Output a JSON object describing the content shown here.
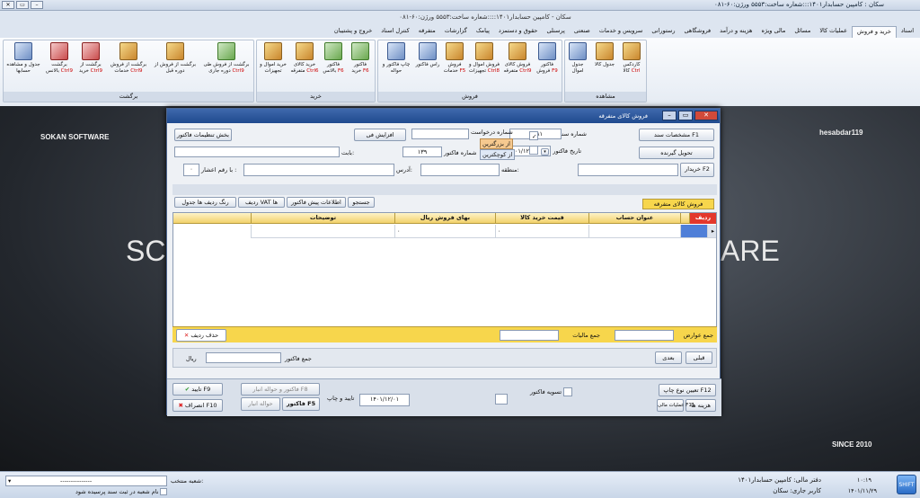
{
  "window": {
    "title": "سکان : کامپین حسابدار۱۴۰۱:::شعاره ساخت:۵۵۵۳    ورژن:۶۰-۰۸۱"
  },
  "app_title": "سکان - کامپین حسابدار۱۴۰۱::::شعاره ساخت:۵۵۵۳    ورژن:۶۰-۰۸۱",
  "tabs": [
    "اسناد",
    "خرید و فروش",
    "عملیات کالا",
    "مسائل",
    "مالی ویژه",
    "هزینه و درآمد",
    "فروشگاهی",
    "رستورانی",
    "سرویس و خدمات",
    "صنعتی",
    "پرسنلی",
    "حقوق و دستمزد",
    "پیامک",
    "گزارشات",
    "متفرقه",
    "کنترل اسناد",
    "خروج و پشتیبان"
  ],
  "ribbon": {
    "groups": [
      {
        "label": "مشاهده",
        "buttons": [
          {
            "l1": "کاردکس",
            "l2": "کالا",
            "hk": "Ctrl"
          },
          {
            "l1": "جدول کالا",
            "l2": "",
            "hk": ""
          },
          {
            "l1": "جدول",
            "l2": "اموال",
            "hk": ""
          }
        ]
      },
      {
        "label": "فروش",
        "buttons": [
          {
            "l1": "فاکتور",
            "l2": "فروش",
            "hk": "F9"
          },
          {
            "l1": "فروش کالای",
            "l2": "متفرقه",
            "hk": "Ctrl9"
          },
          {
            "l1": "فروش اموال و",
            "l2": "تجهیزات",
            "hk": "Ctrl8"
          },
          {
            "l1": "فروش",
            "l2": "خدمات",
            "hk": "F5"
          },
          {
            "l1": "راس فاکتور",
            "l2": "",
            "hk": ""
          },
          {
            "l1": "چاپ فاکتور و",
            "l2": "حواله",
            "hk": ""
          }
        ]
      },
      {
        "label": "خرید",
        "buttons": [
          {
            "l1": "فاکتور",
            "l2": "خرید",
            "hk": "F6"
          },
          {
            "l1": "فاکتور",
            "l2": "بالانس",
            "hk": "F6"
          },
          {
            "l1": "خرید کالای",
            "l2": "متفرقه",
            "hk": "Ctrl6"
          },
          {
            "l1": "خرید اموال و",
            "l2": "تجهیزات",
            "hk": ""
          }
        ]
      },
      {
        "label": "برگشت",
        "buttons": [
          {
            "l1": "برگشت از فروش طی",
            "l2": "دوره جاری",
            "hk": "Ctrl9"
          },
          {
            "l1": "برگشت از فروش از",
            "l2": "دوره قبل",
            "hk": ""
          },
          {
            "l1": "برگشت از فروش",
            "l2": "خدمات",
            "hk": "Ctrl9"
          },
          {
            "l1": "برگشت از",
            "l2": "خرید",
            "hk": "Ctrl9"
          },
          {
            "l1": "برگشت",
            "l2": "بالانس",
            "hk": "Ctrl9"
          },
          {
            "l1": "جدول و مشاهده",
            "l2": "حسابها",
            "hk": ""
          }
        ]
      }
    ]
  },
  "desktop": {
    "left_brand": "SOKAN SOFTWARE",
    "right_brand": "hesabdar119",
    "since": "SINCE 2010",
    "big_left": "SC",
    "big_right": "ARE"
  },
  "dialog": {
    "title": "فروش کالای متفرقه",
    "btn_header": "مشخصات سند F1",
    "btn_delivery": "تحویل گیرنده",
    "btn_settings": "بخش تنظیمات فاکتور",
    "lbl_doc_no": "شماره سند",
    "doc_no": "۱،۳۸۱",
    "lbl_invoice_date": "تاریخ فاکتور",
    "invoice_date": "۱۴۰۱/۱۲/۰۱",
    "lbl_request_no": "شماره درخواست",
    "opt_big": "از بزرگترین",
    "opt_small": "از کوچکترین",
    "lbl_invoice_no": "شماره فاکتور",
    "invoice_no": "۱۳۹",
    "btn_increase": "افزایش فی",
    "lbl_for": "بابت:",
    "btn_buyer": "خریدار F2",
    "lbl_region": "منطقه:",
    "lbl_address": "آدرس:",
    "lbl_decimal": "با رقم اعشار :",
    "decimal": "۰",
    "section_title": "فروش کالای متفرقه",
    "subtabs": [
      "جستجو",
      "اطلاعات پیش فاکتور",
      "ردیف VAT ها",
      "رنگ ردیف ها جدول"
    ],
    "grid_headers": [
      "ردیف",
      "عنوان حساب",
      "قیمت خرید کالا",
      "بهای فروش   ریال",
      "توضیحات"
    ],
    "grid_row": [
      "",
      "",
      "۰",
      "۰",
      ""
    ],
    "btn_delete_row": "حذف ردیف",
    "lbl_sum_duties": "جمع عوارض",
    "lbl_sum_tax": "جمع مالیات",
    "btn_prev": "قبلی",
    "btn_next": "بعدی",
    "lbl_sum_invoice": "جمع فاکتور",
    "lbl_rial": "ریال",
    "btn_print_type": "تعیین نوع چاپ F12",
    "btn_costs": "هزینه ها",
    "btn_ops": "عملیات مالی F11",
    "lbl_settle": "تسویه فاکتور",
    "bottom_date": "۱۴۰۱/۱۲/۰۱",
    "lbl_confirm_print": "تایید و چاپ",
    "btn_invoice_f5": "فاکتور F5",
    "btn_warehouse_receipt": "حواله انبار",
    "btn_invoice_warehouse": "فاکتور و حواله انبار F8",
    "btn_confirm": "تایید F9",
    "btn_cancel": "انصراف F10"
  },
  "status": {
    "fiscal_label": "دفتر مالی: کامپین حسابدار۱۴۰۱",
    "user_label": "کاربر جاری: سکان",
    "time": "۱۰:۱۹",
    "date": "۱۴۰۱/۱۱/۲۹",
    "branch_label": "شعبه منتخب:",
    "branch_hint": "نام شعبه در ثبت سند پرسیده شود",
    "branch_value": "---------------"
  }
}
